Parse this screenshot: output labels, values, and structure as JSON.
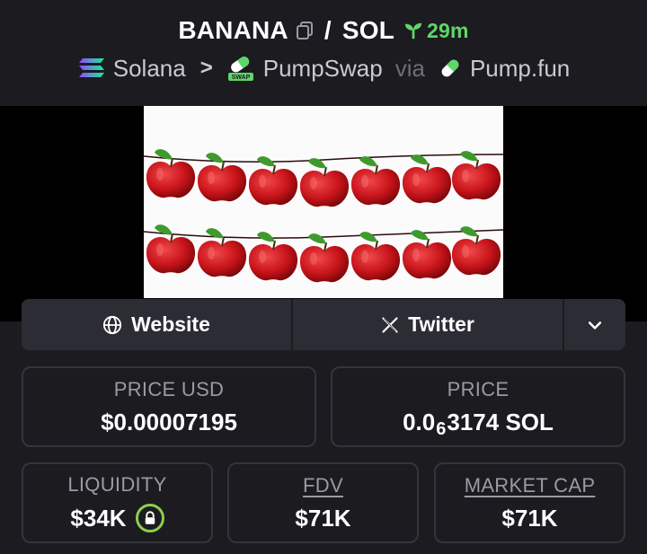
{
  "header": {
    "token": "BANANA",
    "slash": "/",
    "quote": "SOL",
    "age": "29m",
    "chain": "Solana",
    "separator": ">",
    "dex": "PumpSwap",
    "dex_badge": "SWAP",
    "via": "via",
    "launchpad": "Pump.fun"
  },
  "links": {
    "website": "Website",
    "twitter": "Twitter"
  },
  "stats": {
    "price_usd_label": "PRICE USD",
    "price_usd": "$0.00007195",
    "price_label": "PRICE",
    "price_prefix": "0.0",
    "price_zeros": "6",
    "price_suffix": "3174 SOL",
    "liquidity_label": "LIQUIDITY",
    "liquidity": "$34K",
    "fdv_label": "FDV",
    "fdv": "$71K",
    "mcap_label": "MARKET CAP",
    "mcap": "$71K"
  },
  "colors": {
    "background": "#1b1b20",
    "age_green": "#5fd66a",
    "lock_green": "#8fcd4c",
    "apple_red": "#c8141a",
    "leaf_green": "#3f9a2e"
  }
}
